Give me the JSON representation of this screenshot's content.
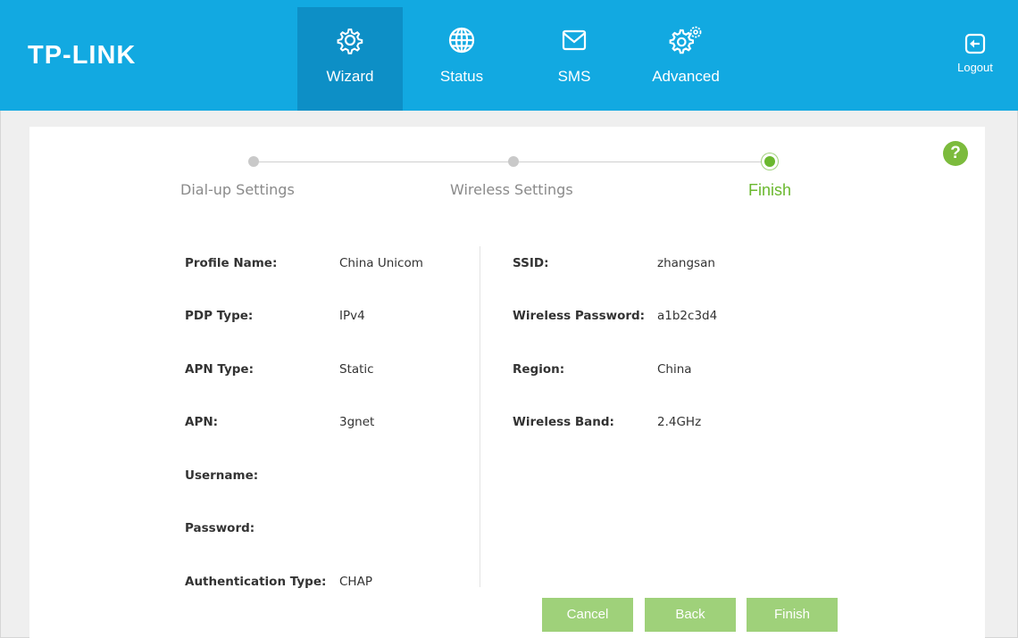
{
  "header": {
    "logo": "TP-LINK",
    "nav": [
      {
        "label": "Wizard",
        "icon": "gear-icon",
        "active": true
      },
      {
        "label": "Status",
        "icon": "globe-icon",
        "active": false
      },
      {
        "label": "SMS",
        "icon": "envelope-icon",
        "active": false
      },
      {
        "label": "Advanced",
        "icon": "gears-icon",
        "active": false
      }
    ],
    "logout_label": "Logout"
  },
  "help_label": "?",
  "steps": [
    {
      "label": "Dial-up Settings",
      "state": "done"
    },
    {
      "label": "Wireless Settings",
      "state": "done"
    },
    {
      "label": "Finish",
      "state": "current"
    }
  ],
  "summary": {
    "left": [
      {
        "label": "Profile Name:",
        "value": "China Unicom"
      },
      {
        "label": "PDP Type:",
        "value": "IPv4"
      },
      {
        "label": "APN Type:",
        "value": "Static"
      },
      {
        "label": "APN:",
        "value": "3gnet"
      },
      {
        "label": "Username:",
        "value": ""
      },
      {
        "label": "Password:",
        "value": ""
      },
      {
        "label": "Authentication Type:",
        "value": "CHAP"
      }
    ],
    "right": [
      {
        "label": "SSID:",
        "value": "zhangsan"
      },
      {
        "label": "Wireless Password:",
        "value": "a1b2c3d4"
      },
      {
        "label": "Region:",
        "value": "China"
      },
      {
        "label": "Wireless Band:",
        "value": "2.4GHz"
      }
    ]
  },
  "buttons": {
    "cancel": "Cancel",
    "back": "Back",
    "finish": "Finish"
  },
  "colors": {
    "header": "#12a9e1",
    "header_active": "#0d8fc6",
    "accent_green": "#6ab82e",
    "button_green": "#9fd17a"
  }
}
